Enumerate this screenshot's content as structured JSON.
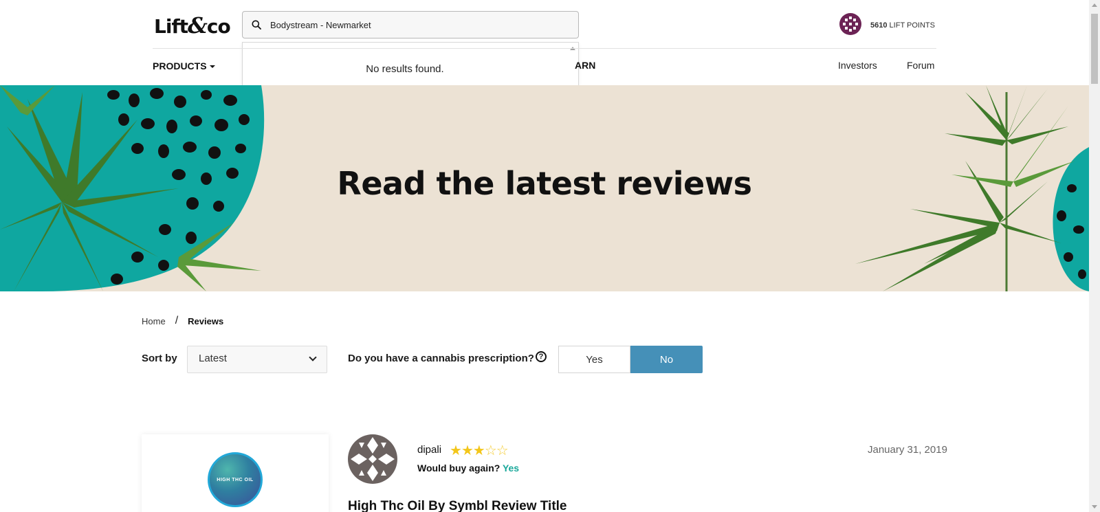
{
  "header": {
    "logo_text_left": "Lift",
    "logo_amp": "&",
    "logo_text_right": "co",
    "search": {
      "value": "Bodystream - Newmarket"
    },
    "dropdown_message": "No results found.",
    "points_value": "5610",
    "points_label": "LIFT POINTS",
    "nav": {
      "products": "PRODUCTS",
      "learn_partial": "ARN",
      "investors": "Investors",
      "forum": "Forum"
    }
  },
  "hero": {
    "title": "Read the latest reviews"
  },
  "breadcrumb": {
    "home": "Home",
    "separator": "/",
    "current": "Reviews"
  },
  "filters": {
    "sort_label": "Sort by",
    "sort_value": "Latest",
    "prescription_question": "Do you have a cannabis prescription?",
    "help_glyph": "?",
    "yes_label": "Yes",
    "no_label": "No",
    "selected": "No"
  },
  "review": {
    "product_image_text": "HIGH THC OIL",
    "username": "dipali",
    "rating": 3,
    "rating_max": 5,
    "buy_again_label": "Would buy again?",
    "buy_again_value": "Yes",
    "date": "January 31, 2019",
    "title": "High Thc Oil By Symbl Review Title"
  },
  "colors": {
    "accent_blue": "#4590b8",
    "teal": "#19a89a",
    "hero_bg": "#ece2d4",
    "star": "#f3c61a",
    "points_icon": "#6c2355"
  },
  "icons": [
    "search-icon",
    "lift-points-icon",
    "caret-down-icon",
    "chevron-down-icon",
    "help-icon",
    "star-icon"
  ]
}
